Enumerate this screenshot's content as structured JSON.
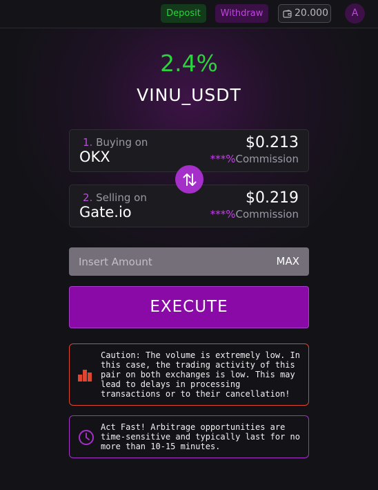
{
  "header": {
    "deposit_label": "Deposit",
    "withdraw_label": "Withdraw",
    "balance": "20.000",
    "avatar_initial": "A"
  },
  "opportunity": {
    "percent": "2.4%",
    "pair": "VINU_USDT"
  },
  "buy": {
    "step_num": "1.",
    "step_label": "Buying on",
    "exchange": "OKX",
    "price": "$0.213",
    "commission_stars": "***%",
    "commission_label": "Commission"
  },
  "sell": {
    "step_num": "2.",
    "step_label": "Selling on",
    "exchange": "Gate.io",
    "price": "$0.219",
    "commission_stars": "***%",
    "commission_label": "Commission"
  },
  "amount": {
    "placeholder": "Insert Amount",
    "max_label": "MAX"
  },
  "execute_label": "EXECUTE",
  "caution": {
    "icon": "bar-chart-icon",
    "text": "Caution: The volume is extremely low. In this case, the trading activity of this pair on both exchanges is low. This may lead to delays in processing transactions or to their cancellation!"
  },
  "act_fast": {
    "icon": "clock-icon",
    "text": "Act Fast! Arbitrage opportunities are time-sensitive and typically last for no more than 10-15 minutes."
  },
  "colors": {
    "green": "#2bd33c",
    "purple": "#8a0aa8",
    "accent_purple": "#c045e0",
    "caution_red": "#e0452f"
  }
}
